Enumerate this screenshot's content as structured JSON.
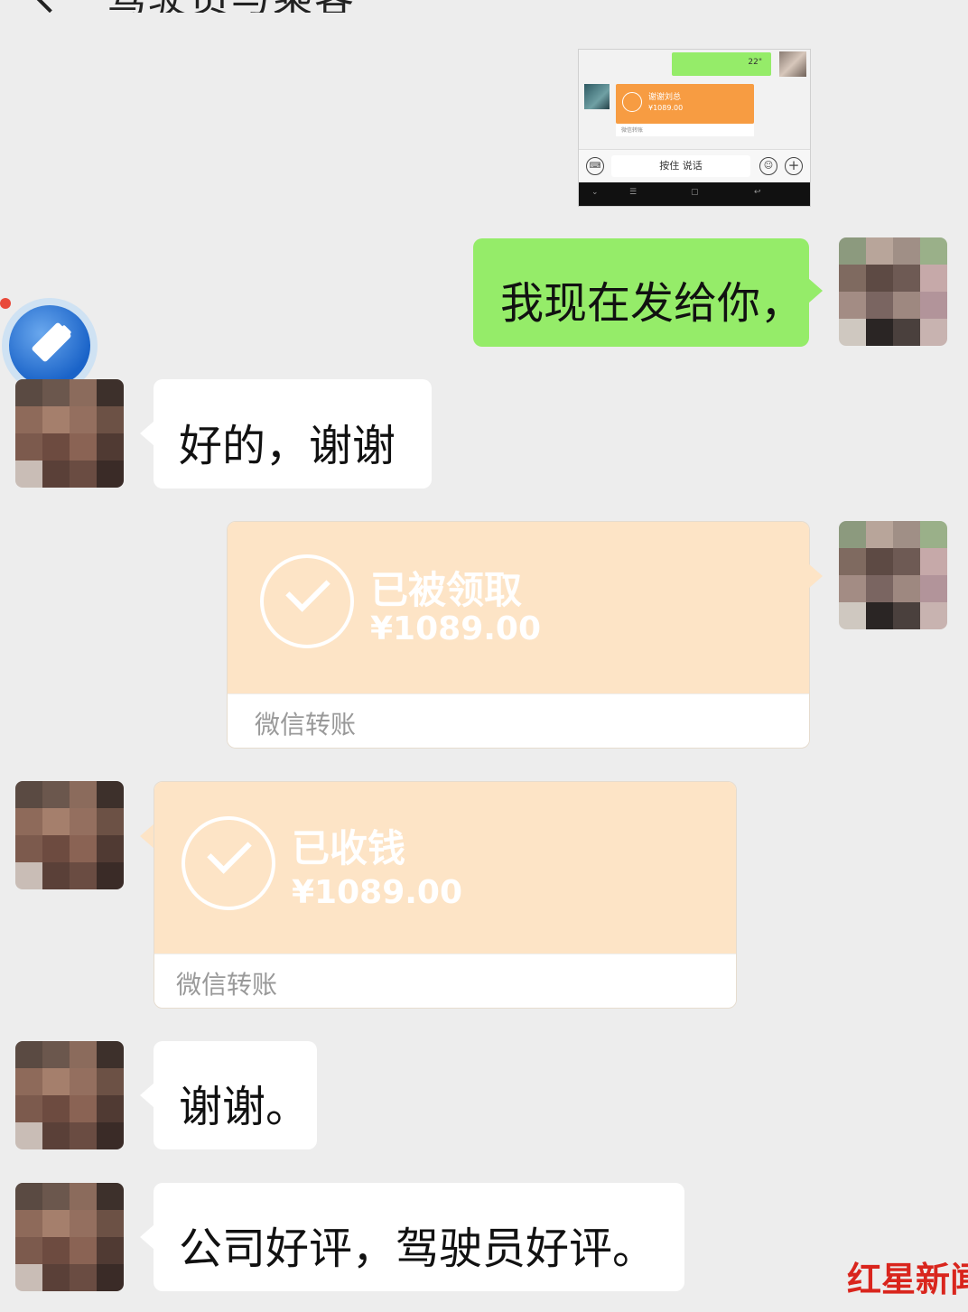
{
  "header": {
    "back_icon": "chevron-left-icon",
    "title": "驾驶员与乘客"
  },
  "thumbnail": {
    "message_time": "22\"",
    "transfer_title": "谢谢刘总",
    "transfer_amount": "¥1089.00",
    "transfer_note": "微信转账",
    "press_to_talk": "按住 说话"
  },
  "messages": [
    {
      "side": "right",
      "type": "text",
      "text": "我现在发给你，"
    },
    {
      "side": "left",
      "type": "text",
      "text": "好的，谢谢"
    },
    {
      "side": "right",
      "type": "transfer",
      "status": "已被领取",
      "amount": "¥1089.00",
      "label": "微信转账"
    },
    {
      "side": "left",
      "type": "transfer",
      "status": "已收钱",
      "amount": "¥1089.00",
      "label": "微信转账"
    },
    {
      "side": "left",
      "type": "text",
      "text": "谢谢。"
    },
    {
      "side": "left",
      "type": "text",
      "text": "公司好评，驾驶员好评。"
    }
  ],
  "watermark": {
    "brand": "红星新闻"
  },
  "colors": {
    "background": "#ededed",
    "sent_bubble": "#95ec69",
    "received_bubble": "#ffffff",
    "transfer_card": "#fde4c6",
    "watermark": "#d9251d"
  }
}
